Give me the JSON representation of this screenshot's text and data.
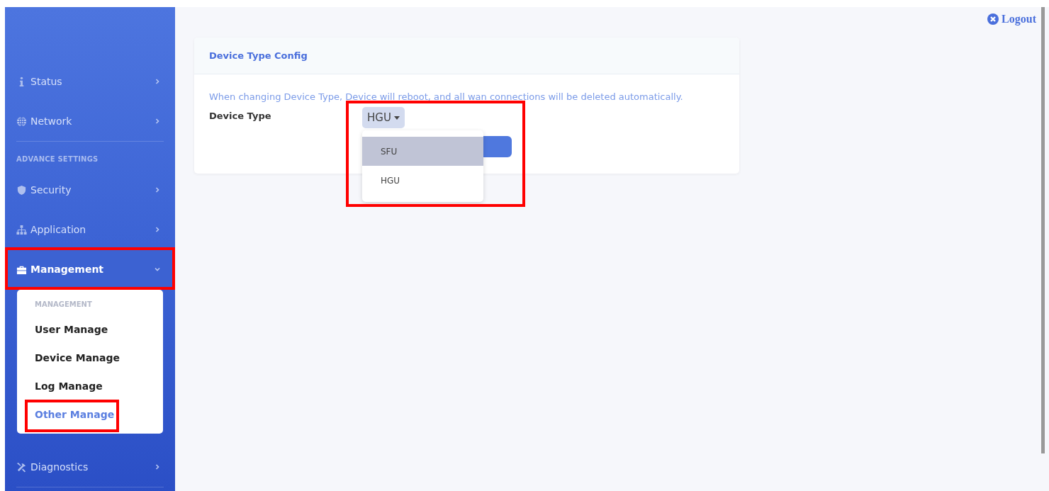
{
  "sidebar": {
    "sections": [
      {
        "items": [
          {
            "label": "Status",
            "expanded": false,
            "selected": false,
            "highlighted": false
          },
          {
            "label": "Network",
            "expanded": false,
            "selected": false,
            "highlighted": false
          }
        ]
      },
      {
        "header": "ADVANCE SETTINGS",
        "items": [
          {
            "label": "Security",
            "expanded": false,
            "selected": false,
            "highlighted": false
          },
          {
            "label": "Application",
            "expanded": false,
            "selected": false,
            "highlighted": false
          },
          {
            "label": "Management",
            "expanded": true,
            "selected": true,
            "highlighted": true,
            "submenu": {
              "header": "MANAGEMENT",
              "items": [
                {
                  "label": "User Manage",
                  "selected": false,
                  "highlighted": false
                },
                {
                  "label": "Device Manage",
                  "selected": false,
                  "highlighted": false
                },
                {
                  "label": "Log Manage",
                  "selected": false,
                  "highlighted": false
                },
                {
                  "label": "Other Manage",
                  "selected": true,
                  "highlighted": true
                }
              ]
            }
          },
          {
            "label": "Diagnostics",
            "expanded": false,
            "selected": false,
            "highlighted": false
          }
        ]
      }
    ]
  },
  "logout": "Logout",
  "card": {
    "title": "Device Type Config",
    "notice": "When changing Device Type, Device will reboot, and all wan connections will be deleted automatically.",
    "field": {
      "label": "Device Type",
      "value": "HGU",
      "open": true,
      "highlighted": true,
      "options": [
        {
          "label": "SFU",
          "highlighted": true
        },
        {
          "label": "HGU",
          "highlighted": false
        }
      ]
    }
  }
}
